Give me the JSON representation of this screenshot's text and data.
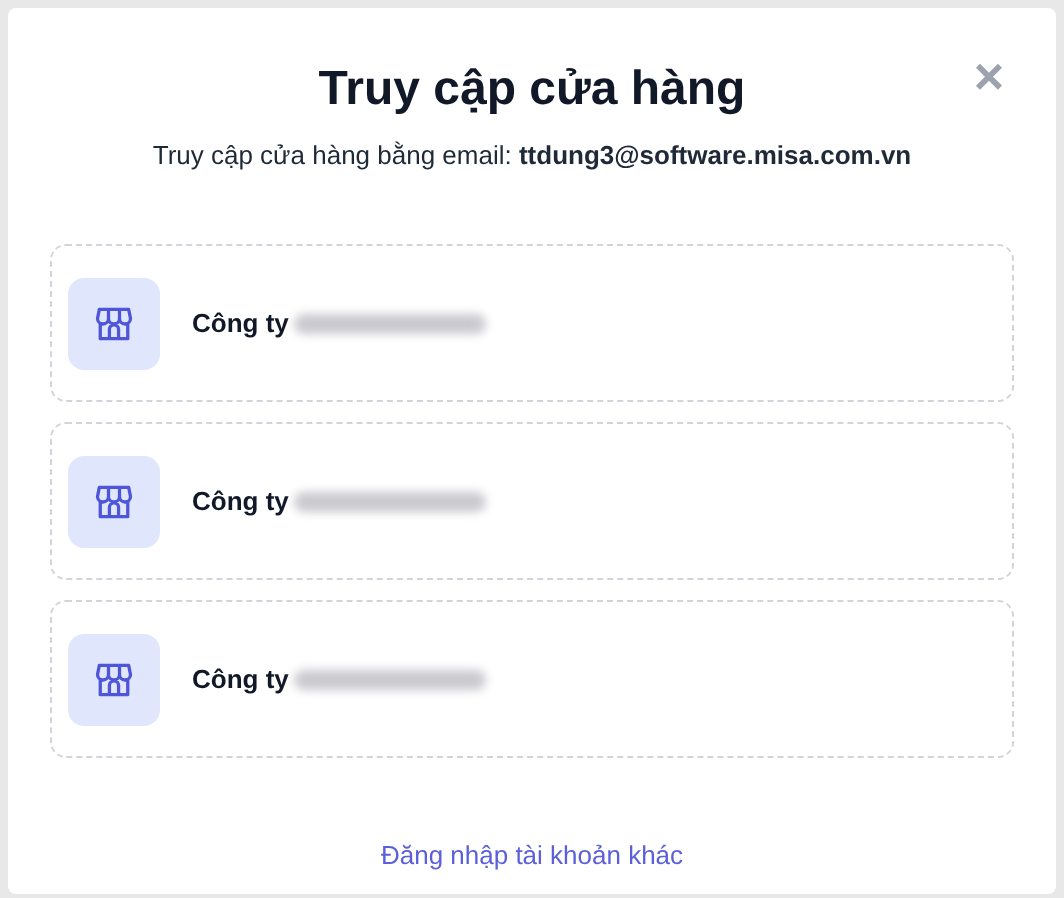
{
  "dialog": {
    "title": "Truy cập cửa hàng",
    "subtitle": "Truy cập cửa hàng bằng email: **ttdung3@software.misa.com.vn**",
    "close": "×"
  },
  "stores": [
    {
      "label": "Công ty",
      "name_hidden": true
    },
    {
      "label": "Công ty",
      "name_hidden": true
    },
    {
      "label": "Công ty",
      "name_hidden": true
    }
  ],
  "footer_link": "Đăng nhập tài khoản khác"
}
